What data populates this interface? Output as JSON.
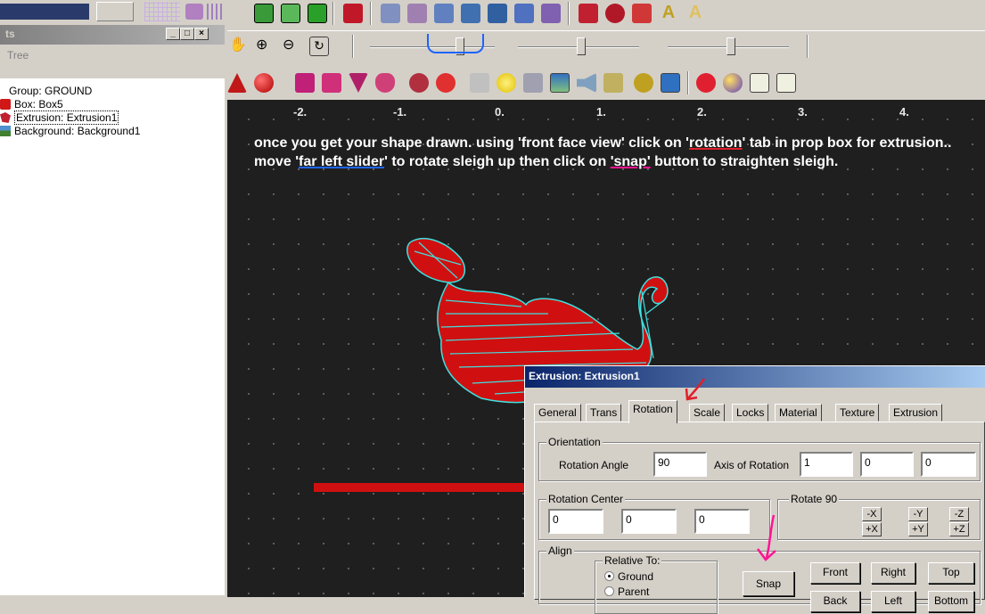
{
  "left_panel": {
    "title": "ts",
    "tab_label": "Tree",
    "tree_items": [
      {
        "label": "Group: GROUND"
      },
      {
        "label": "Box: Box5"
      },
      {
        "label": "Extrusion: Extrusion1"
      },
      {
        "label": "Background: Background1"
      }
    ]
  },
  "viewport": {
    "axis_ticks": [
      "-2.",
      "-1.",
      "0.",
      "1.",
      "2.",
      "3.",
      "4."
    ],
    "instruction_parts": {
      "p1": "once you get your shape drawn. using 'front face view' click on '",
      "rotation": "rotation",
      "p2": "' tab in prop box for extrusion.. move '",
      "far_left_slider": "far left slider",
      "p3": "' to rotate sleigh up then click on ",
      "snap": "'snap'",
      "p4": " button to straighten sleigh."
    }
  },
  "dialog": {
    "title": "Extrusion: Extrusion1",
    "tabs": [
      "General",
      "Trans",
      "Rotation",
      "Scale",
      "Locks",
      "Material",
      "Texture",
      "Extrusion"
    ],
    "active_tab": "Rotation",
    "orientation": {
      "group_label": "Orientation",
      "angle_label": "Rotation Angle",
      "angle_value": "90",
      "axis_label": "Axis of Rotation",
      "axis_x": "1",
      "axis_y": "0",
      "axis_z": "0"
    },
    "rotation_center": {
      "group_label": "Rotation Center",
      "x": "0",
      "y": "0",
      "z": "0"
    },
    "rotate90": {
      "group_label": "Rotate 90",
      "buttons": [
        "-X",
        "-Y",
        "-Z",
        "+X",
        "+Y",
        "+Z"
      ]
    },
    "align": {
      "group_label": "Align",
      "relative_label": "Relative To:",
      "options": [
        "Ground",
        "Parent"
      ],
      "selected": "Ground",
      "snap_label": "Snap",
      "view_buttons": [
        "Front",
        "Right",
        "Top",
        "Back",
        "Left",
        "Bottom"
      ]
    }
  },
  "colors": {
    "viewport_bg": "#1f1f1f",
    "dialog_title": "#0a246a",
    "shape_fill": "#d01010",
    "shape_edges": "#40e0e0",
    "annotation_red": "#e0202a",
    "annotation_blue": "#1e64ff",
    "annotation_pink": "#ff1493"
  }
}
